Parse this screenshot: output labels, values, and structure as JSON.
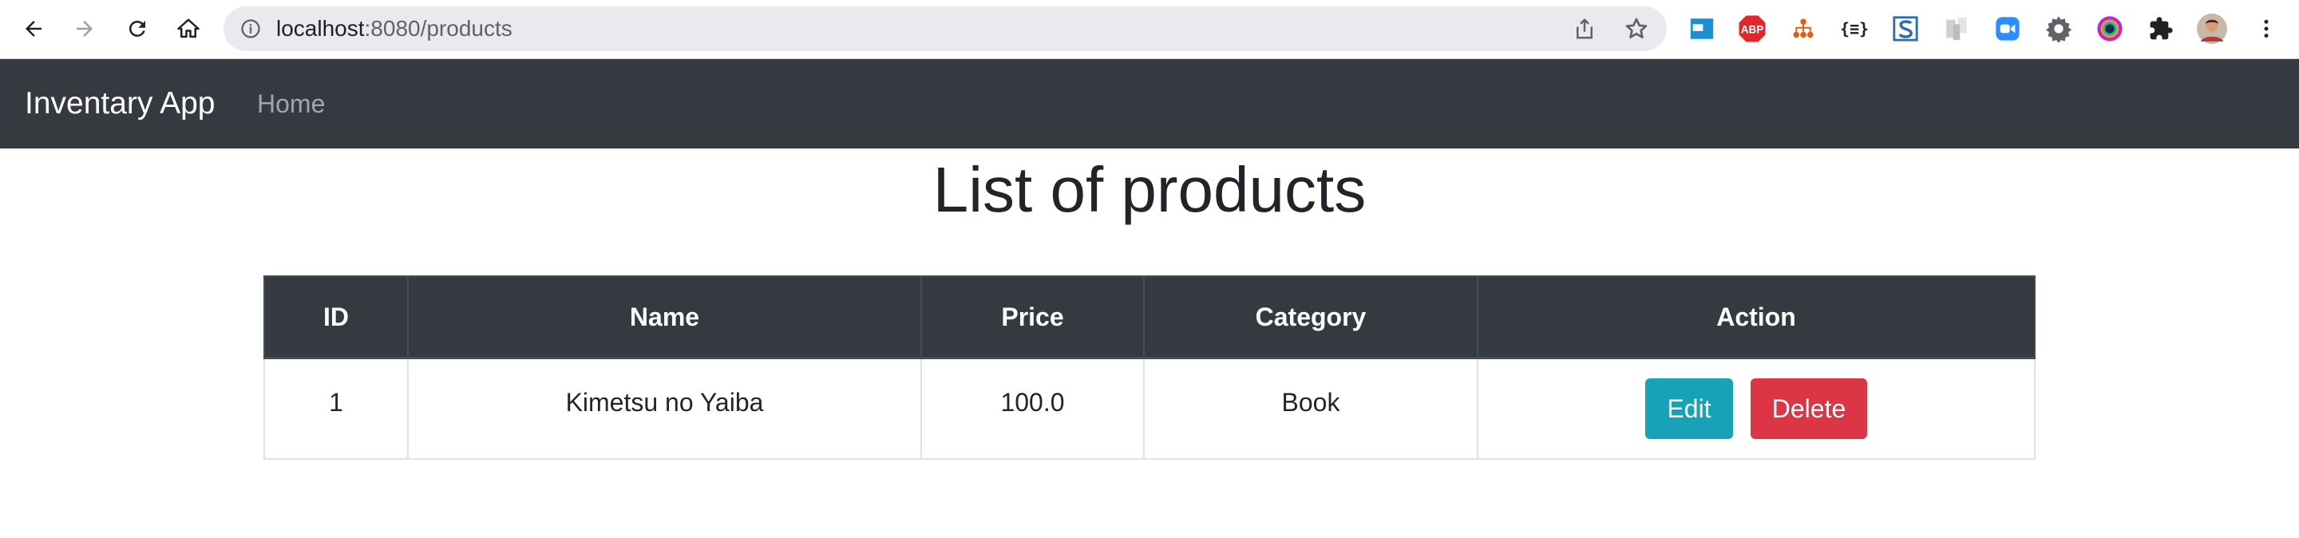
{
  "browser": {
    "url_host": "localhost",
    "url_path": ":8080/products",
    "extensions": [
      "tab-manager-icon",
      "adblock-plus-icon",
      "sitemap-icon",
      "json-formatter-icon",
      "s-extension-icon",
      "bookmark-manager-icon",
      "zoom-icon",
      "gear-icon",
      "color-picker-icon",
      "puzzle-icon",
      "profile-avatar"
    ],
    "adblock_label": "ABP",
    "json_label": "{≡}"
  },
  "navbar": {
    "brand": "Inventary App",
    "home_label": "Home"
  },
  "main": {
    "title": "List of products",
    "table": {
      "headers": [
        "ID",
        "Name",
        "Price",
        "Category",
        "Action"
      ],
      "rows": [
        {
          "id": "1",
          "name": "Kimetsu no Yaiba",
          "price": "100.0",
          "category": "Book",
          "edit_label": "Edit",
          "delete_label": "Delete"
        }
      ]
    }
  },
  "colors": {
    "navbar_bg": "#343a40",
    "edit_btn": "#17a2b8",
    "delete_btn": "#dc3545"
  }
}
